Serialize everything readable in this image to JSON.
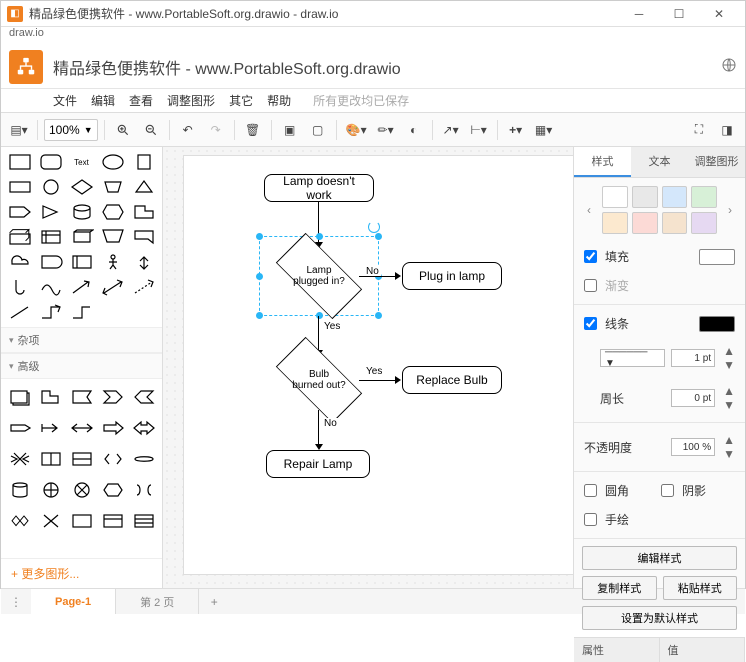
{
  "window": {
    "title": "精品绿色便携软件 - www.PortableSoft.org.drawio - draw.io",
    "address": "draw.io"
  },
  "doc": {
    "title": "精品绿色便携软件 - www.PortableSoft.org.drawio"
  },
  "menu": {
    "file": "文件",
    "edit": "编辑",
    "view": "查看",
    "arrange": "调整图形",
    "extras": "其它",
    "help": "帮助",
    "saved": "所有更改均已保存"
  },
  "toolbar": {
    "zoom": "100%"
  },
  "sidebar": {
    "misc": "杂项",
    "advanced": "高级",
    "more": "+ 更多图形..."
  },
  "flow": {
    "n1": "Lamp doesn't work",
    "d1": "Lamp\nplugged in?",
    "n2": "Plug in lamp",
    "d2": "Bulb\nburned out?",
    "n3": "Replace Bulb",
    "n4": "Repair Lamp",
    "no": "No",
    "yes": "Yes"
  },
  "right": {
    "tab_style": "样式",
    "tab_text": "文本",
    "tab_arrange": "调整图形",
    "fill": "填充",
    "gradient": "渐变",
    "line": "线条",
    "perimeter": "周长",
    "opacity": "不透明度",
    "rounded": "圆角",
    "shadow": "阴影",
    "sketch": "手绘",
    "editstyle": "编辑样式",
    "copystyle": "复制样式",
    "pastestyle": "粘贴样式",
    "setdefault": "设置为默认样式",
    "propname": "属性",
    "propval": "值",
    "linewidth": "1 pt",
    "perimval": "0 pt",
    "opacval": "100 %"
  },
  "pages": {
    "p1": "Page-1",
    "p2": "第 2 页"
  }
}
